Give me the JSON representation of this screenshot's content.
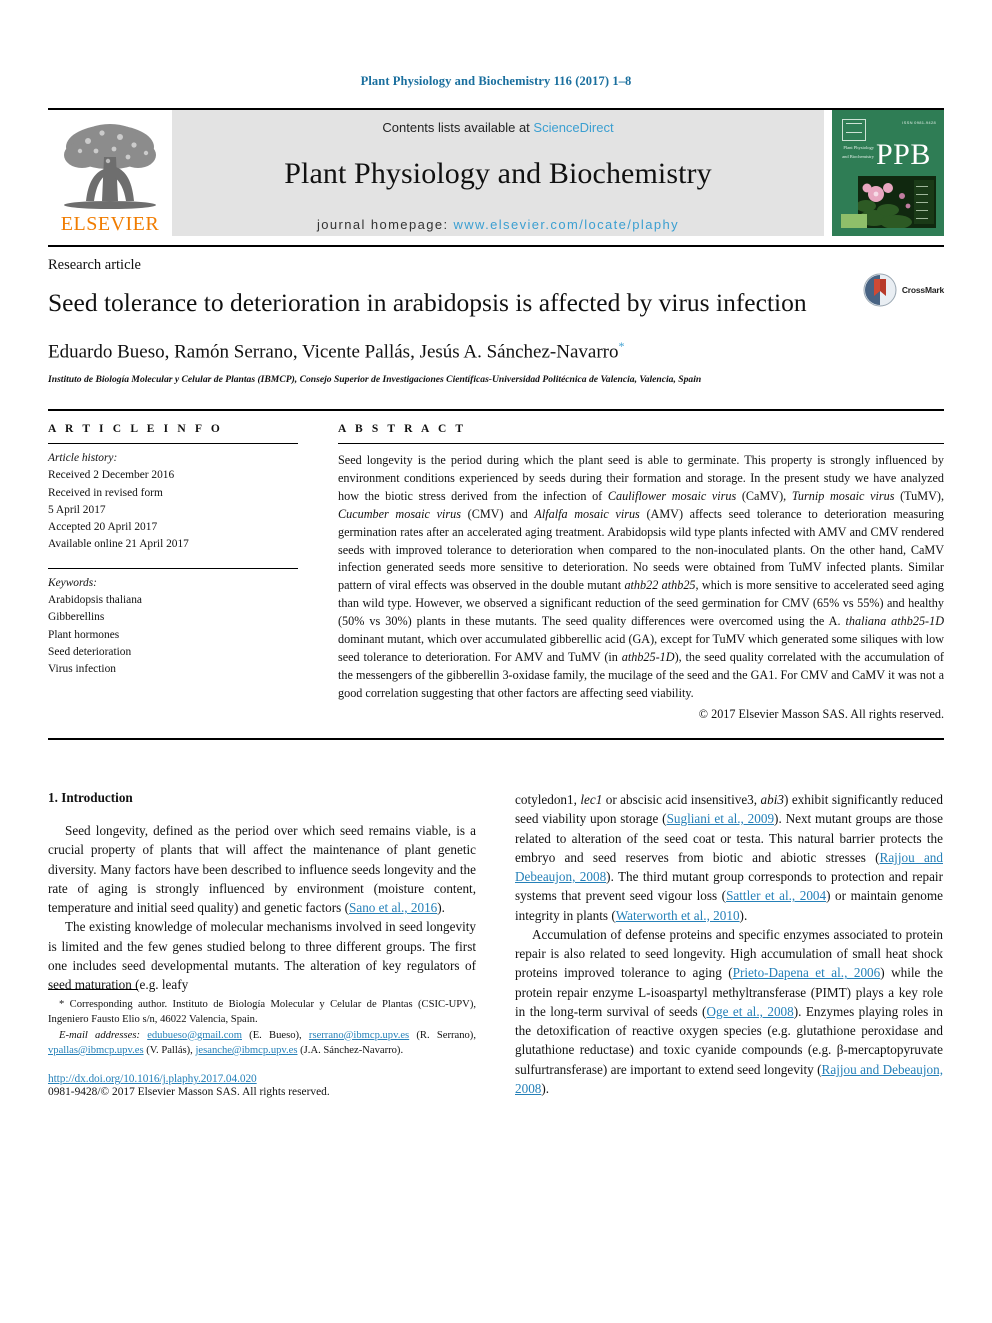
{
  "running_head": "Plant Physiology and Biochemistry 116 (2017) 1–8",
  "masthead": {
    "publisher_name": "ELSEVIER",
    "contents_prefix": "Contents lists available at ",
    "contents_link": "ScienceDirect",
    "journal_title": "Plant Physiology and Biochemistry",
    "homepage_prefix": "journal homepage: ",
    "homepage_url": "www.elsevier.com/locate/plaphy",
    "cover_acronym": "PPB",
    "cover_code": "ISSN 0981-9428",
    "cover_sidetext": "Plant Physiology and Biochemistry"
  },
  "article": {
    "type": "Research article",
    "title": "Seed tolerance to deterioration in arabidopsis is affected by virus infection",
    "authors": "Eduardo Bueso, Ramón Serrano, Vicente Pallás, Jesús A. Sánchez-Navarro",
    "corresponding_marker": "*",
    "affiliation": "Instituto de Biología Molecular y Celular de Plantas (IBMCP), Consejo Superior de Investigaciones Científicas-Universidad Politécnica de Valencia, Valencia, Spain",
    "crossmark_label": "CrossMark"
  },
  "article_info": {
    "label": "A R T I C L E  I N F O",
    "history_heading": "Article history:",
    "history": [
      "Received 2 December 2016",
      "Received in revised form",
      "5 April 2017",
      "Accepted 20 April 2017",
      "Available online 21 April 2017"
    ],
    "keywords_heading": "Keywords:",
    "keywords": [
      "Arabidopsis thaliana",
      "Gibberellins",
      "Plant hormones",
      "Seed deterioration",
      "Virus infection"
    ]
  },
  "abstract": {
    "label": "A B S T R A C T",
    "text_parts": [
      {
        "t": "Seed longevity is the period during which the plant seed is able to germinate. This property is strongly influenced by environment conditions experienced by seeds during their formation and storage. In the present study we have analyzed how the biotic stress derived from the infection of ",
        "i": false
      },
      {
        "t": "Cauliflower mosaic virus",
        "i": true
      },
      {
        "t": " (CaMV), ",
        "i": false
      },
      {
        "t": "Turnip mosaic virus",
        "i": true
      },
      {
        "t": " (TuMV), ",
        "i": false
      },
      {
        "t": "Cucumber mosaic virus",
        "i": true
      },
      {
        "t": " (CMV) and ",
        "i": false
      },
      {
        "t": "Alfalfa mosaic virus",
        "i": true
      },
      {
        "t": " (AMV) affects seed tolerance to deterioration measuring germination rates after an accelerated aging treatment. Arabidopsis wild type plants infected with AMV and CMV rendered seeds with improved tolerance to deterioration when compared to the non-inoculated plants. On the other hand, CaMV infection generated seeds more sensitive to deterioration. No seeds were obtained from TuMV infected plants. Similar pattern of viral effects was observed in the double mutant ",
        "i": false
      },
      {
        "t": "athb22 athb25",
        "i": true
      },
      {
        "t": ", which is more sensitive to accelerated seed aging than wild type. However, we observed a significant reduction of the seed germination for CMV (65% vs 55%) and healthy (50% vs 30%) plants in these mutants. The seed quality differences were overcomed using the A. ",
        "i": false
      },
      {
        "t": "thaliana athb25-1D",
        "i": true
      },
      {
        "t": " dominant mutant, which over accumulated gibberellic acid (GA), except for TuMV which generated some siliques with low seed tolerance to deterioration. For AMV and TuMV (in ",
        "i": false
      },
      {
        "t": "athb25-1D",
        "i": true
      },
      {
        "t": "), the seed quality correlated with the accumulation of the messengers of the gibberellin 3-oxidase family, the mucilage of the seed and the GA1. For CMV and CaMV it was not a good correlation suggesting that other factors are affecting seed viability.",
        "i": false
      }
    ],
    "copyright": "© 2017 Elsevier Masson SAS. All rights reserved."
  },
  "introduction": {
    "heading": "1. Introduction",
    "left_paragraphs": [
      [
        {
          "t": "Seed longevity, defined as the period over which seed remains viable, is a crucial property of plants that will affect the maintenance of plant genetic diversity. Many factors have been described to influence seeds longevity and the rate of aging is strongly influenced by environment (moisture content, temperature and initial seed quality) and genetic factors (",
          "k": "plain"
        },
        {
          "t": "Sano et al., 2016",
          "k": "ref"
        },
        {
          "t": ").",
          "k": "plain"
        }
      ],
      [
        {
          "t": "The existing knowledge of molecular mechanisms involved in seed longevity is limited and the few genes studied belong to three different groups. The first one includes seed developmental mutants. The alteration of key regulators of seed maturation (e.g. leafy",
          "k": "plain"
        }
      ]
    ],
    "right_paragraphs": [
      [
        {
          "t": "cotyledon1, ",
          "k": "plain"
        },
        {
          "t": "lec1",
          "k": "italic"
        },
        {
          "t": " or abscisic acid insensitive3, ",
          "k": "plain"
        },
        {
          "t": "abi3",
          "k": "italic"
        },
        {
          "t": ") exhibit significantly reduced seed viability upon storage (",
          "k": "plain"
        },
        {
          "t": "Sugliani et al., 2009",
          "k": "ref"
        },
        {
          "t": "). Next mutant groups are those related to alteration of the seed coat or testa. This natural barrier protects the embryo and seed reserves from biotic and abiotic stresses (",
          "k": "plain"
        },
        {
          "t": "Rajjou and Debeaujon, 2008",
          "k": "ref"
        },
        {
          "t": "). The third mutant group corresponds to protection and repair systems that prevent seed vigour loss (",
          "k": "plain"
        },
        {
          "t": "Sattler et al., 2004",
          "k": "ref"
        },
        {
          "t": ") or maintain genome integrity in plants (",
          "k": "plain"
        },
        {
          "t": "Waterworth et al., 2010",
          "k": "ref"
        },
        {
          "t": ").",
          "k": "plain"
        }
      ],
      [
        {
          "t": "Accumulation of defense proteins and specific enzymes associated to protein repair is also related to seed longevity. High accumulation of small heat shock proteins improved tolerance to aging (",
          "k": "plain"
        },
        {
          "t": "Prieto-Dapena et al., 2006",
          "k": "ref"
        },
        {
          "t": ") while the protein repair enzyme L-isoaspartyl methyltransferase (PIMT) plays a key role in the long-term survival of seeds (",
          "k": "plain"
        },
        {
          "t": "Oge et al., 2008",
          "k": "ref"
        },
        {
          "t": "). Enzymes playing roles in the detoxification of reactive oxygen species (e.g. glutathione peroxidase and glutathione reductase) and toxic cyanide compounds (e.g. β-mercaptopyruvate sulfurtransferase) are important to extend seed longevity (",
          "k": "plain"
        },
        {
          "t": "Rajjou and Debeaujon, 2008",
          "k": "ref"
        },
        {
          "t": ").",
          "k": "plain"
        }
      ]
    ]
  },
  "footnotes": {
    "corresponding": [
      {
        "t": "* Corresponding author. Instituto de Biología Molecular y Celular de Plantas (CSIC-UPV), Ingeniero Fausto Elio s/n, 46022 Valencia, Spain.",
        "k": "plain"
      }
    ],
    "emails": [
      {
        "t": "E-mail addresses:",
        "k": "label"
      },
      {
        "t": " ",
        "k": "plain"
      },
      {
        "t": "edubueso@gmail.com",
        "k": "mail"
      },
      {
        "t": " (E. Bueso), ",
        "k": "plain"
      },
      {
        "t": "rserrano@ibmcp.upv.es",
        "k": "mail"
      },
      {
        "t": " (R. Serrano), ",
        "k": "plain"
      },
      {
        "t": "vpallas@ibmcp.upv.es",
        "k": "mail"
      },
      {
        "t": " (V. Pallás), ",
        "k": "plain"
      },
      {
        "t": "jesanche@ibmcp.upv.es",
        "k": "mail"
      },
      {
        "t": " (J.A. Sánchez-Navarro).",
        "k": "plain"
      }
    ],
    "doi": "http://dx.doi.org/10.1016/j.plaphy.2017.04.020",
    "issn_line": "0981-9428/© 2017 Elsevier Masson SAS. All rights reserved."
  },
  "colors": {
    "header_blue": "#1a6f9e",
    "link_blue": "#2580b8",
    "sciencedirect_blue": "#3b9fd1",
    "elsevier_orange": "#f07c00",
    "cover_green": "#2f7d55",
    "band_gray": "#e3e3e3"
  }
}
